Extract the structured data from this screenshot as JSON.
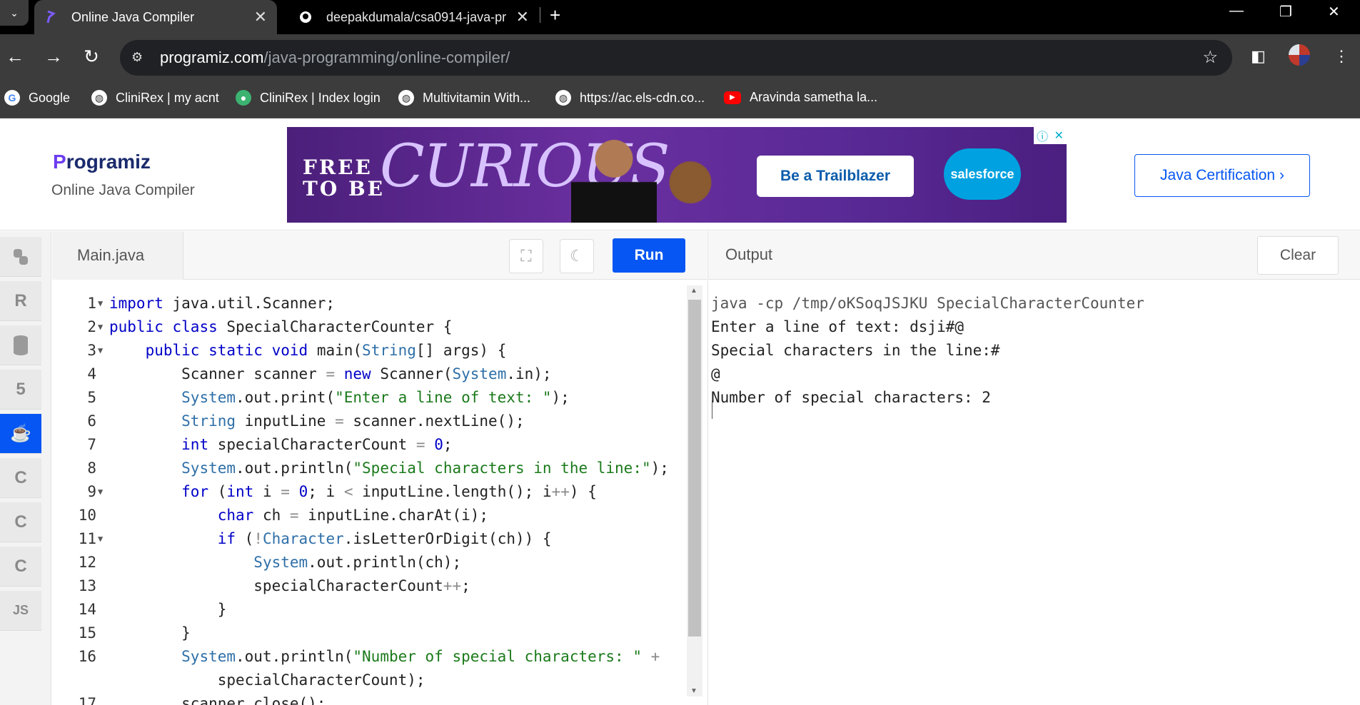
{
  "browser": {
    "tabs": [
      {
        "title": "Online Java Compiler",
        "active": true
      },
      {
        "title": "deepakdumala/csa0914-java-pr",
        "active": false
      }
    ],
    "url_host": "programiz.com",
    "url_path": "/java-programming/online-compiler/",
    "bookmarks": [
      {
        "label": "Google",
        "icon": "google-icon"
      },
      {
        "label": "CliniRex | my acnt",
        "icon": "globe-icon"
      },
      {
        "label": "CliniRex | Index login",
        "icon": "clinirex-icon"
      },
      {
        "label": "Multivitamin With...",
        "icon": "globe-icon"
      },
      {
        "label": "https://ac.els-cdn.co...",
        "icon": "globe-icon"
      },
      {
        "label": "Aravinda sametha la...",
        "icon": "youtube-icon"
      }
    ]
  },
  "site": {
    "logo": "rogramiz",
    "logo_letter": "P",
    "subtitle": "Online Java Compiler",
    "cert_button": "Java Certification ›"
  },
  "ad": {
    "free_line1": "FREE",
    "free_line2": "TO BE",
    "curious": "CURIOUS",
    "cta": "Be a Trailblazer",
    "brand": "salesforce"
  },
  "languages": [
    "python-icon",
    "r-icon",
    "database-icon",
    "html5-icon",
    "java-icon",
    "c-icon",
    "cpp-icon",
    "csharp-icon",
    "js-icon"
  ],
  "languages_label_js": "JS",
  "editor": {
    "file_name": "Main.java",
    "run_label": "Run",
    "line_numbers": [
      "1",
      "2",
      "3",
      "4",
      "5",
      "6",
      "7",
      "8",
      "9",
      "10",
      "11",
      "12",
      "13",
      "14",
      "15",
      "16",
      "",
      "17"
    ]
  },
  "output": {
    "title": "Output",
    "clear_label": "Clear",
    "lines": [
      "java -cp /tmp/oKSoqJSJKU SpecialCharacterCounter",
      "Enter a line of text: dsji#@",
      "Special characters in the line:#",
      "@",
      "Number of special characters: 2"
    ]
  },
  "colors": {
    "accent": "#0556f3",
    "keyword": "#0000c8",
    "string": "#1b7a1b"
  }
}
